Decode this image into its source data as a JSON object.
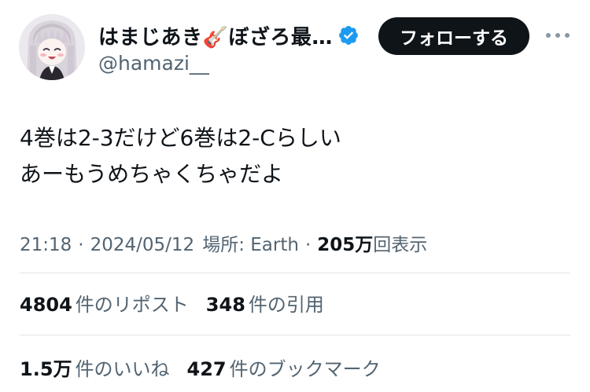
{
  "user": {
    "display_name": "はまじあき🎸ぼざろ最…",
    "handle": "@hamazi__",
    "verified": true,
    "verified_color": "#1d9bf0",
    "avatar_icon": "user-avatar-image"
  },
  "actions": {
    "follow_label": "フォローする",
    "more_icon": "more-horizontal-icon"
  },
  "tweet": {
    "lines": [
      "4巻は2-3だけど6巻は2-Cらしい",
      "あーもうめちゃくちゃだよ"
    ]
  },
  "meta": {
    "time": "21:18",
    "date": "2024/05/12",
    "location": "場所: Earth",
    "views_count": "205万",
    "views_label": "回表示"
  },
  "stats": {
    "reposts": {
      "count": "4804",
      "label": "件のリポスト"
    },
    "quotes": {
      "count": "348",
      "label": "件の引用"
    },
    "likes": {
      "count": "1.5万",
      "label": "件のいいね"
    },
    "bookmarks": {
      "count": "427",
      "label": "件のブックマーク"
    }
  },
  "colors": {
    "text_primary": "#0f1419",
    "text_secondary": "#536471",
    "follow_bg": "#0f1419",
    "divider": "#e1e4e8"
  }
}
